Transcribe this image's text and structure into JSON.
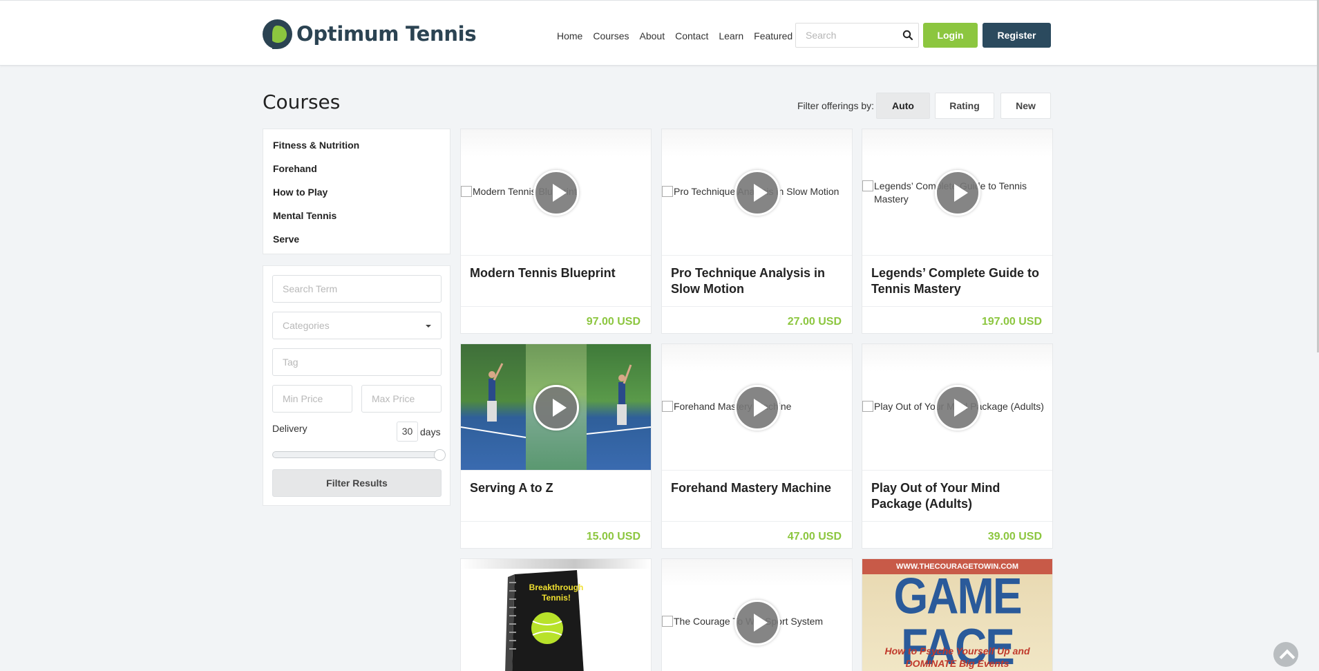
{
  "brand": {
    "name": "Optimum Tennis",
    "accent": "#8cc63f",
    "dark": "#2b4a5e"
  },
  "nav": [
    "Home",
    "Courses",
    "About",
    "Contact",
    "Learn",
    "Featured"
  ],
  "search": {
    "placeholder": "Search"
  },
  "auth": {
    "login": "Login",
    "register": "Register"
  },
  "page": {
    "title": "Courses"
  },
  "filters": {
    "label": "Filter offerings by:",
    "options": [
      "Auto",
      "Rating",
      "New"
    ],
    "selected": "Auto"
  },
  "categories": [
    "Fitness & Nutrition",
    "Forehand",
    "How to Play",
    "Mental Tennis",
    "Serve"
  ],
  "search_form": {
    "term_placeholder": "Search Term",
    "categories_placeholder": "Categories",
    "tag_placeholder": "Tag",
    "min_price_placeholder": "Min Price",
    "max_price_placeholder": "Max Price",
    "delivery_label": "Delivery",
    "delivery_value": "30",
    "delivery_unit": "days",
    "slider_fraction": 1.0,
    "submit": "Filter Results"
  },
  "courses": [
    {
      "title": "Modern Tennis Blueprint",
      "alt": "Modern Tennis Blueprint",
      "price": "97.00 USD"
    },
    {
      "title": "Pro Technique Analysis in Slow Motion",
      "alt": "Pro Technique Analysis in Slow Motion",
      "price": "27.00 USD"
    },
    {
      "title": "Legends’ Complete Guide to Tennis Mastery",
      "alt": "Legends’ Complete Guide to Tennis Mastery",
      "price": "197.00 USD"
    },
    {
      "title": "Serving A to Z",
      "alt": "",
      "price": "15.00 USD"
    },
    {
      "title": "Forehand Mastery Machine",
      "alt": "Forehand Mastery Machine",
      "price": "47.00 USD"
    },
    {
      "title": "Play Out of Your Mind Package (Adults)",
      "alt": "Play Out of Your Mind Package (Adults)",
      "price": "39.00 USD"
    },
    {
      "title": "",
      "alt": "",
      "price": ""
    },
    {
      "title": "",
      "alt": "The Courage To Win Sport System",
      "price": ""
    },
    {
      "title": "",
      "alt": "",
      "price": ""
    }
  ],
  "ebook_cover": {
    "line1": "Breakthrough",
    "line2": "Tennis!"
  },
  "gameface_cover": {
    "url": "WWW.THECOURAGETOWIN.COM",
    "title": "GAME FACE",
    "subtitle1": "How to Psyche Yourself Up and",
    "subtitle2": "DOMINATE Big Events"
  }
}
